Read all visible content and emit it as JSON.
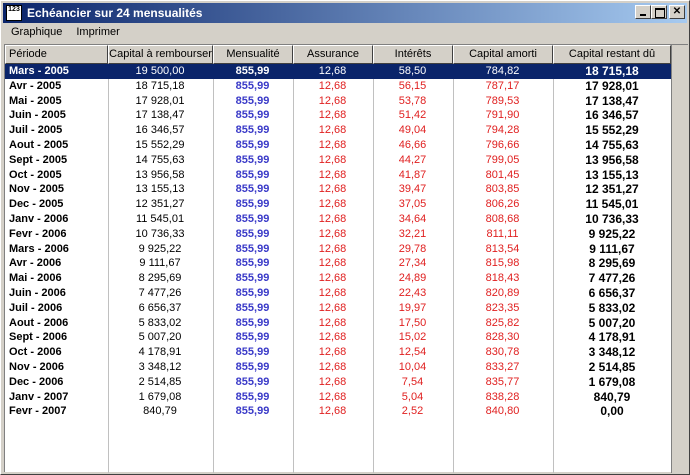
{
  "window": {
    "title": "Echéancier sur 24 mensualités",
    "icon_label": "123"
  },
  "title_buttons": {
    "minimize": "",
    "maximize": "",
    "close": "✕"
  },
  "menu": {
    "items": [
      {
        "label": "Graphique"
      },
      {
        "label": "Imprimer"
      }
    ]
  },
  "colors": {
    "titlebar": "#0a246a",
    "selected_row": "#0a246a",
    "mensualite_text": "#3a3ac8",
    "red_text": "#e02020"
  },
  "table": {
    "columns": [
      "Période",
      "Capital à rembourser",
      "Mensualité",
      "Assurance",
      "Intérêts",
      "Capital amorti",
      "Capital restant dû"
    ],
    "selected_index": 0,
    "rows": [
      [
        "Mars - 2005",
        "19 500,00",
        "855,99",
        "12,68",
        "58,50",
        "784,82",
        "18 715,18"
      ],
      [
        "Avr - 2005",
        "18 715,18",
        "855,99",
        "12,68",
        "56,15",
        "787,17",
        "17 928,01"
      ],
      [
        "Mai - 2005",
        "17 928,01",
        "855,99",
        "12,68",
        "53,78",
        "789,53",
        "17 138,47"
      ],
      [
        "Juin - 2005",
        "17 138,47",
        "855,99",
        "12,68",
        "51,42",
        "791,90",
        "16 346,57"
      ],
      [
        "Juil - 2005",
        "16 346,57",
        "855,99",
        "12,68",
        "49,04",
        "794,28",
        "15 552,29"
      ],
      [
        "Aout - 2005",
        "15 552,29",
        "855,99",
        "12,68",
        "46,66",
        "796,66",
        "14 755,63"
      ],
      [
        "Sept - 2005",
        "14 755,63",
        "855,99",
        "12,68",
        "44,27",
        "799,05",
        "13 956,58"
      ],
      [
        "Oct - 2005",
        "13 956,58",
        "855,99",
        "12,68",
        "41,87",
        "801,45",
        "13 155,13"
      ],
      [
        "Nov - 2005",
        "13 155,13",
        "855,99",
        "12,68",
        "39,47",
        "803,85",
        "12 351,27"
      ],
      [
        "Dec - 2005",
        "12 351,27",
        "855,99",
        "12,68",
        "37,05",
        "806,26",
        "11 545,01"
      ],
      [
        "Janv - 2006",
        "11 545,01",
        "855,99",
        "12,68",
        "34,64",
        "808,68",
        "10 736,33"
      ],
      [
        "Fevr - 2006",
        "10 736,33",
        "855,99",
        "12,68",
        "32,21",
        "811,11",
        "9 925,22"
      ],
      [
        "Mars - 2006",
        "9 925,22",
        "855,99",
        "12,68",
        "29,78",
        "813,54",
        "9 111,67"
      ],
      [
        "Avr - 2006",
        "9 111,67",
        "855,99",
        "12,68",
        "27,34",
        "815,98",
        "8 295,69"
      ],
      [
        "Mai - 2006",
        "8 295,69",
        "855,99",
        "12,68",
        "24,89",
        "818,43",
        "7 477,26"
      ],
      [
        "Juin - 2006",
        "7 477,26",
        "855,99",
        "12,68",
        "22,43",
        "820,89",
        "6 656,37"
      ],
      [
        "Juil - 2006",
        "6 656,37",
        "855,99",
        "12,68",
        "19,97",
        "823,35",
        "5 833,02"
      ],
      [
        "Aout - 2006",
        "5 833,02",
        "855,99",
        "12,68",
        "17,50",
        "825,82",
        "5 007,20"
      ],
      [
        "Sept - 2006",
        "5 007,20",
        "855,99",
        "12,68",
        "15,02",
        "828,30",
        "4 178,91"
      ],
      [
        "Oct - 2006",
        "4 178,91",
        "855,99",
        "12,68",
        "12,54",
        "830,78",
        "3 348,12"
      ],
      [
        "Nov - 2006",
        "3 348,12",
        "855,99",
        "12,68",
        "10,04",
        "833,27",
        "2 514,85"
      ],
      [
        "Dec - 2006",
        "2 514,85",
        "855,99",
        "12,68",
        "7,54",
        "835,77",
        "1 679,08"
      ],
      [
        "Janv - 2007",
        "1 679,08",
        "855,99",
        "12,68",
        "5,04",
        "838,28",
        "840,79"
      ],
      [
        "Fevr - 2007",
        "840,79",
        "855,99",
        "12,68",
        "2,52",
        "840,80",
        "0,00"
      ]
    ]
  }
}
